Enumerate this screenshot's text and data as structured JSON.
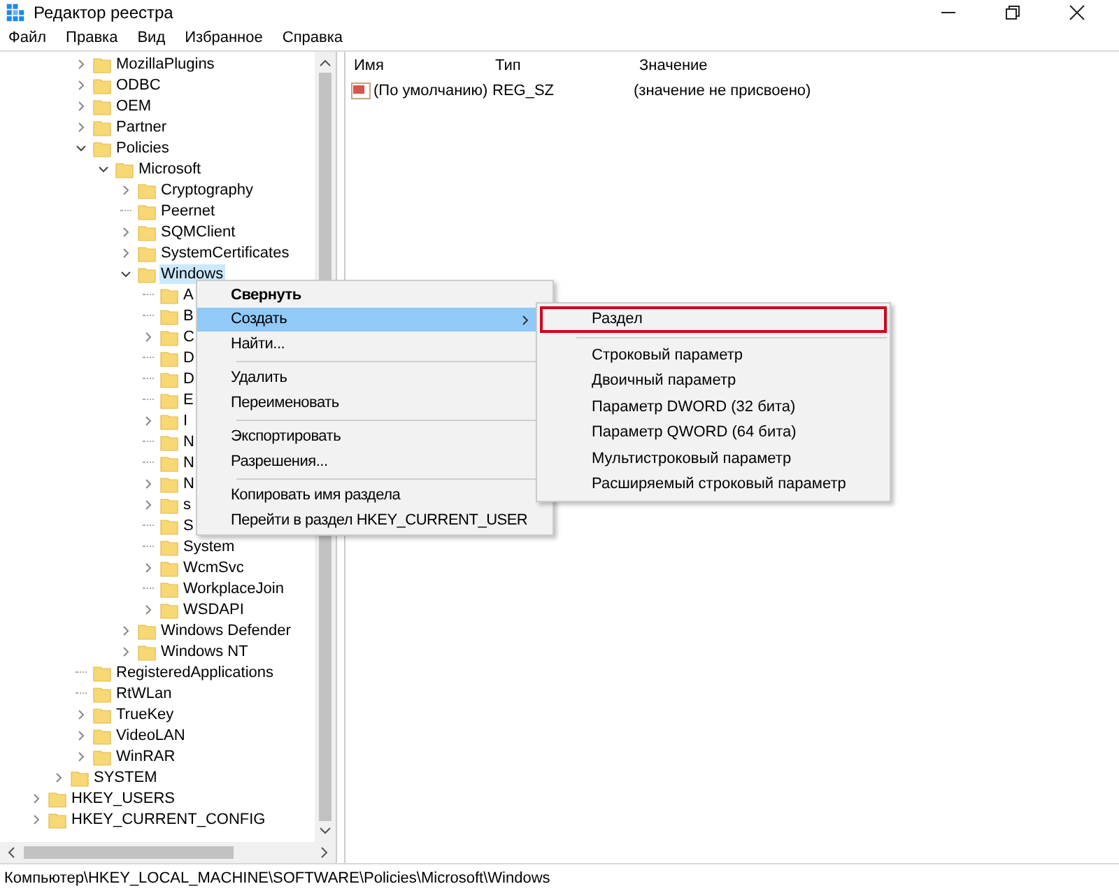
{
  "window": {
    "title": "Редактор реестра"
  },
  "menu_bar": [
    "Файл",
    "Правка",
    "Вид",
    "Избранное",
    "Справка"
  ],
  "tree": [
    {
      "children": [
        {
          "children": [
            {
              "label": "MozillaPlugins",
              "expanded": false,
              "selected": false
            },
            {
              "label": "ODBC",
              "expanded": false,
              "selected": false
            },
            {
              "label": "OEM",
              "expanded": false,
              "selected": false
            },
            {
              "label": "Partner",
              "expanded": false,
              "selected": false
            },
            {
              "label": "Policies",
              "expanded": true,
              "selected": false,
              "children": [
                {
                  "label": "Microsoft",
                  "expanded": true,
                  "selected": false,
                  "children": [
                    {
                      "label": "Cryptography",
                      "expanded": false,
                      "selected": false
                    },
                    {
                      "label": "Peernet",
                      "selected": false
                    },
                    {
                      "label": "SQMClient",
                      "expanded": false,
                      "selected": false
                    },
                    {
                      "label": "SystemCertificates",
                      "expanded": false,
                      "selected": false
                    },
                    {
                      "label": "Windows",
                      "expanded": true,
                      "selected": true,
                      "children": [
                        {
                          "label": "A",
                          "selected": false
                        },
                        {
                          "label": "B",
                          "selected": false
                        },
                        {
                          "label": "C",
                          "expanded": false,
                          "selected": false
                        },
                        {
                          "label": "D",
                          "selected": false
                        },
                        {
                          "label": "D",
                          "selected": false
                        },
                        {
                          "label": "E",
                          "selected": false
                        },
                        {
                          "label": "I",
                          "expanded": false,
                          "selected": false
                        },
                        {
                          "label": "N",
                          "selected": false
                        },
                        {
                          "label": "N",
                          "selected": false
                        },
                        {
                          "label": "N",
                          "expanded": false,
                          "selected": false
                        },
                        {
                          "label": "s",
                          "expanded": false,
                          "selected": false
                        },
                        {
                          "label": "S",
                          "selected": false
                        },
                        {
                          "label": "System",
                          "selected": false
                        },
                        {
                          "label": "WcmSvc",
                          "expanded": false,
                          "selected": false
                        },
                        {
                          "label": "WorkplaceJoin",
                          "selected": false
                        },
                        {
                          "label": "WSDAPI",
                          "expanded": false,
                          "selected": false
                        }
                      ]
                    },
                    {
                      "label": "Windows Defender",
                      "expanded": false,
                      "selected": false
                    },
                    {
                      "label": "Windows NT",
                      "expanded": false,
                      "selected": false
                    }
                  ]
                }
              ]
            },
            {
              "label": "RegisteredApplications",
              "selected": false
            },
            {
              "label": "RtWLan",
              "selected": false
            },
            {
              "label": "TrueKey",
              "expanded": false,
              "selected": false
            },
            {
              "label": "VideoLAN",
              "expanded": false,
              "selected": false
            },
            {
              "label": "WinRAR",
              "expanded": false,
              "selected": false
            }
          ]
        },
        {
          "label": "SYSTEM",
          "expanded": false,
          "selected": false
        }
      ]
    },
    {
      "label": "HKEY_USERS",
      "expanded": false,
      "selected": false
    },
    {
      "label": "HKEY_CURRENT_CONFIG",
      "expanded": false,
      "selected": false
    }
  ],
  "table": {
    "columns": [
      "Имя",
      "Тип",
      "Значение"
    ],
    "rows": [
      {
        "name": "(По умолчанию)",
        "type": "REG_SZ",
        "value": "(значение не присвоено)"
      }
    ]
  },
  "context_menu": [
    {
      "kind": "item",
      "label": "Свернуть",
      "default": true,
      "submenu": false,
      "selected": false
    },
    {
      "kind": "item",
      "label": "Создать",
      "default": false,
      "submenu": true,
      "selected": true
    },
    {
      "kind": "item",
      "label": "Найти...",
      "default": false,
      "submenu": false,
      "selected": false
    },
    {
      "kind": "separator"
    },
    {
      "kind": "item",
      "label": "Удалить",
      "default": false,
      "submenu": false,
      "selected": false
    },
    {
      "kind": "item",
      "label": "Переименовать",
      "default": false,
      "submenu": false,
      "selected": false
    },
    {
      "kind": "separator"
    },
    {
      "kind": "item",
      "label": "Экспортировать",
      "default": false,
      "submenu": false,
      "selected": false
    },
    {
      "kind": "item",
      "label": "Разрешения...",
      "default": false,
      "submenu": false,
      "selected": false
    },
    {
      "kind": "separator"
    },
    {
      "kind": "item",
      "label": "Копировать имя раздела",
      "default": false,
      "submenu": false,
      "selected": false
    },
    {
      "kind": "item",
      "label": "Перейти в раздел HKEY_CURRENT_USER",
      "default": false,
      "submenu": false,
      "selected": false
    }
  ],
  "submenu": [
    {
      "kind": "item",
      "label": "Раздел",
      "highlighted": true
    },
    {
      "kind": "separator"
    },
    {
      "kind": "item",
      "label": "Строковый параметр",
      "highlighted": false
    },
    {
      "kind": "item",
      "label": "Двоичный параметр",
      "highlighted": false
    },
    {
      "kind": "item",
      "label": "Параметр DWORD (32 бита)",
      "highlighted": false
    },
    {
      "kind": "item",
      "label": "Параметр QWORD (64 бита)",
      "highlighted": false
    },
    {
      "kind": "item",
      "label": "Мультистроковый параметр",
      "highlighted": false
    },
    {
      "kind": "item",
      "label": "Расширяемый строковый параметр",
      "highlighted": false
    }
  ],
  "status_bar": "Компьютер\\HKEY_LOCAL_MACHINE\\SOFTWARE\\Policies\\Microsoft\\Windows"
}
